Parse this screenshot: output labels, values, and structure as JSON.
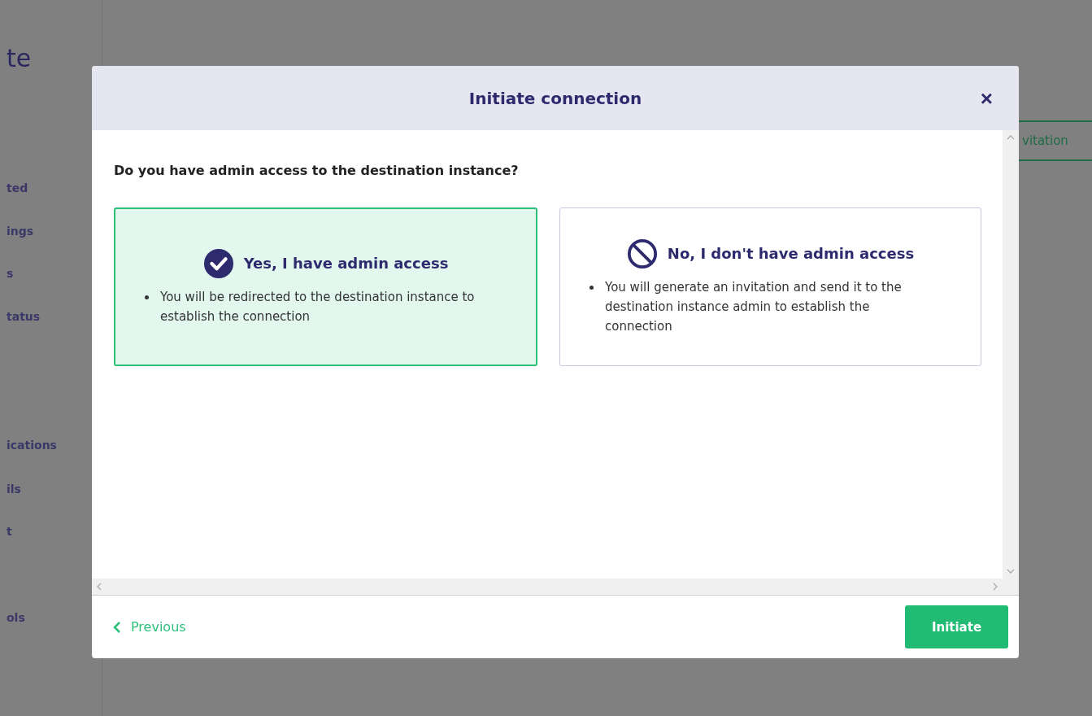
{
  "background": {
    "title_fragment": "te",
    "sidebar_items": [
      "ted",
      "ings",
      "s",
      "tatus",
      "ications",
      "ils",
      "t",
      "ols"
    ],
    "button_fragment": "vitation"
  },
  "dialog": {
    "title": "Initiate connection",
    "close": "×",
    "question": "Do you have admin access to the destination instance?",
    "options": [
      {
        "kind": "yes",
        "title": "Yes, I have admin access",
        "bullet": "You will be redirected to the destination instance to establish the connection",
        "selected": true
      },
      {
        "kind": "no",
        "title": "No, I don't have admin access",
        "bullet": "You will generate an invitation and send it to the destination instance admin to establish the connection",
        "selected": false
      }
    ],
    "previous": "Previous",
    "primary": "Initiate"
  }
}
